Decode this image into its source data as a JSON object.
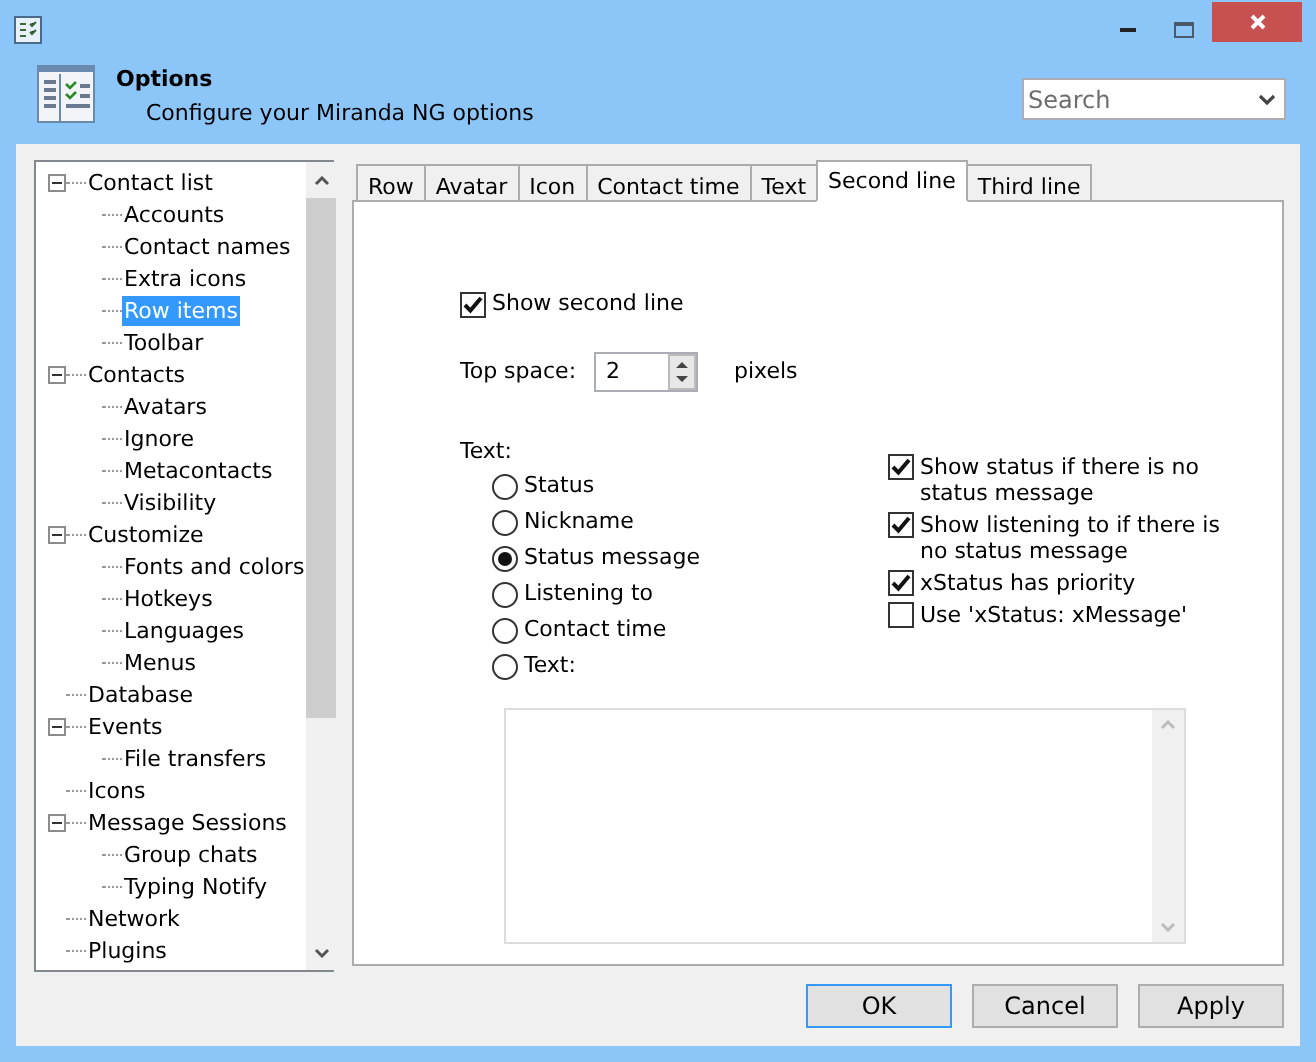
{
  "header": {
    "title": "Options",
    "subtitle": "Configure your Miranda NG options"
  },
  "search": {
    "placeholder": "Search"
  },
  "tree": [
    {
      "label": "Contact list",
      "expanded": true,
      "selected": false,
      "children": [
        {
          "label": "Accounts",
          "selected": false
        },
        {
          "label": "Contact names",
          "selected": false
        },
        {
          "label": "Extra icons",
          "selected": false
        },
        {
          "label": "Row items",
          "selected": true
        },
        {
          "label": "Toolbar",
          "selected": false
        }
      ]
    },
    {
      "label": "Contacts",
      "expanded": true,
      "selected": false,
      "children": [
        {
          "label": "Avatars",
          "selected": false
        },
        {
          "label": "Ignore",
          "selected": false
        },
        {
          "label": "Metacontacts",
          "selected": false
        },
        {
          "label": "Visibility",
          "selected": false
        }
      ]
    },
    {
      "label": "Customize",
      "expanded": true,
      "selected": false,
      "children": [
        {
          "label": "Fonts and colors",
          "selected": false
        },
        {
          "label": "Hotkeys",
          "selected": false
        },
        {
          "label": "Languages",
          "selected": false
        },
        {
          "label": "Menus",
          "selected": false
        }
      ]
    },
    {
      "label": "Database",
      "selected": false
    },
    {
      "label": "Events",
      "expanded": true,
      "selected": false,
      "children": [
        {
          "label": "File transfers",
          "selected": false
        }
      ]
    },
    {
      "label": "Icons",
      "selected": false
    },
    {
      "label": "Message Sessions",
      "expanded": true,
      "selected": false,
      "children": [
        {
          "label": "Group chats",
          "selected": false
        },
        {
          "label": "Typing Notify",
          "selected": false
        }
      ]
    },
    {
      "label": "Network",
      "selected": false
    },
    {
      "label": "Plugins",
      "selected": false
    }
  ],
  "tabs": [
    {
      "label": "Row",
      "selected": false
    },
    {
      "label": "Avatar",
      "selected": false
    },
    {
      "label": "Icon",
      "selected": false
    },
    {
      "label": "Contact time",
      "selected": false
    },
    {
      "label": "Text",
      "selected": false
    },
    {
      "label": "Second line",
      "selected": true
    },
    {
      "label": "Third line",
      "selected": false
    }
  ],
  "show_second_line": {
    "label": "Show second line",
    "checked": true
  },
  "top_space": {
    "label": "Top space:",
    "value": "2",
    "unit": "pixels"
  },
  "text_label": "Text:",
  "text_options": [
    {
      "label": "Status",
      "selected": false
    },
    {
      "label": "Nickname",
      "selected": false
    },
    {
      "label": "Status message",
      "selected": true
    },
    {
      "label": "Listening to",
      "selected": false
    },
    {
      "label": "Contact time",
      "selected": false
    },
    {
      "label": "Text:",
      "selected": false
    }
  ],
  "options": [
    {
      "label": "Show status if there is no status message",
      "checked": true
    },
    {
      "label": "Show listening to if there is no status message",
      "checked": true
    },
    {
      "label": "xStatus has priority",
      "checked": true
    },
    {
      "label": "Use 'xStatus: xMessage'",
      "checked": false
    }
  ],
  "buttons": [
    {
      "label": "OK",
      "default": true
    },
    {
      "label": "Cancel",
      "default": false
    },
    {
      "label": "Apply",
      "default": false
    }
  ]
}
